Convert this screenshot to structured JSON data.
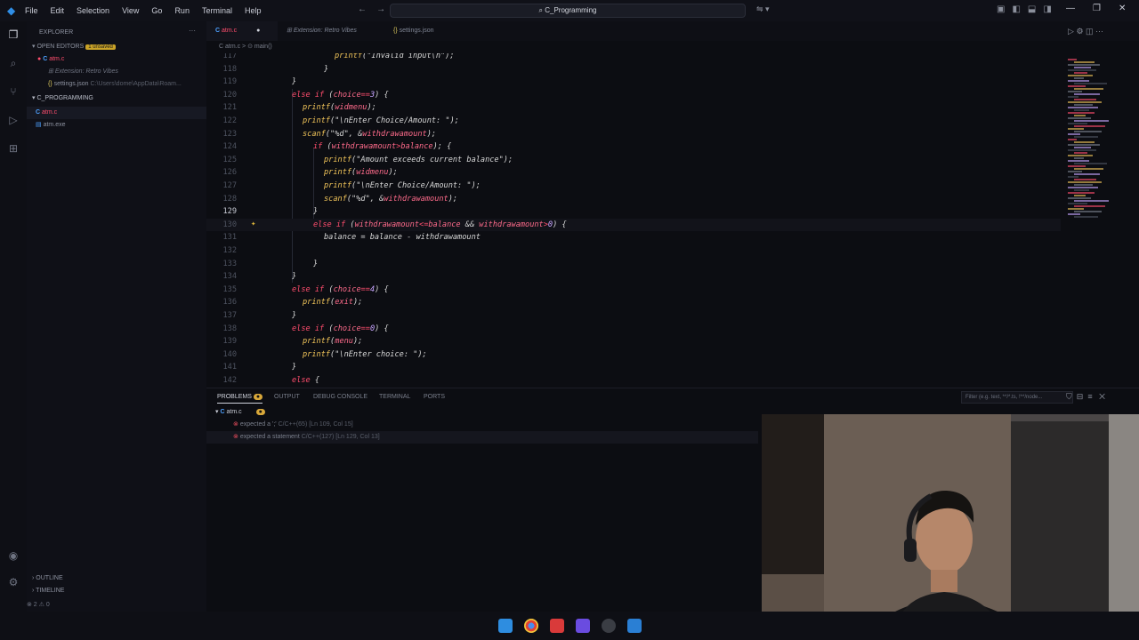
{
  "titlebar": {
    "menu": [
      "File",
      "Edit",
      "Selection",
      "View",
      "Go",
      "Run",
      "Terminal",
      "Help"
    ],
    "search": "C_Programming"
  },
  "sidebar": {
    "title": "EXPLORER",
    "open_editors_label": "OPEN EDITORS",
    "unsaved_badge": "1 unsaved",
    "open_editors": [
      {
        "name": "atm.c",
        "detail": ""
      },
      {
        "name": "Extension: Retro Vibes",
        "detail": ""
      },
      {
        "name": "settings.json",
        "detail": "C:\\Users\\dome\\AppData\\Roam..."
      }
    ],
    "folder_label": "C_PROGRAMMING",
    "files": [
      "atm.c",
      "atm.exe"
    ],
    "outline_label": "OUTLINE",
    "timeline_label": "TIMELINE"
  },
  "tabs": [
    {
      "label": "atm.c",
      "active": true
    },
    {
      "label": "Extension: Retro Vibes",
      "active": false
    },
    {
      "label": "settings.json",
      "active": false
    }
  ],
  "breadcrumb": "C atm.c > ⊙ main()",
  "code_lines": [
    {
      "n": "117",
      "indent": 8,
      "tokens": [
        [
          "fn",
          "printf"
        ],
        [
          "str",
          "(\"Invalid input\\n\");"
        ]
      ]
    },
    {
      "n": "118",
      "indent": 6,
      "tokens": [
        [
          "str",
          "}"
        ]
      ]
    },
    {
      "n": "119",
      "indent": 0,
      "tokens": [
        [
          "str",
          "}"
        ]
      ]
    },
    {
      "n": "120",
      "indent": 0,
      "tokens": [
        [
          "kw",
          "else if"
        ],
        [
          "str",
          " ("
        ],
        [
          "var",
          "choice"
        ],
        [
          "kw",
          "=="
        ],
        [
          "num",
          "3"
        ],
        [
          "str",
          ") {"
        ]
      ]
    },
    {
      "n": "121",
      "indent": 2,
      "tokens": [
        [
          "fn",
          "printf"
        ],
        [
          "str",
          "("
        ],
        [
          "var",
          "widmenu"
        ],
        [
          "str",
          ");"
        ]
      ]
    },
    {
      "n": "122",
      "indent": 2,
      "tokens": [
        [
          "fn",
          "printf"
        ],
        [
          "str",
          "(\"\\nEnter Choice/Amount: \");"
        ]
      ]
    },
    {
      "n": "123",
      "indent": 2,
      "tokens": [
        [
          "fn",
          "scanf"
        ],
        [
          "str",
          "(\"%d\", &"
        ],
        [
          "var",
          "withdrawamount"
        ],
        [
          "str",
          ");"
        ]
      ]
    },
    {
      "n": "124",
      "indent": 4,
      "tokens": [
        [
          "kw",
          "if"
        ],
        [
          "str",
          " ("
        ],
        [
          "var",
          "withdrawamount"
        ],
        [
          "kw",
          ">"
        ],
        [
          "var",
          "balance"
        ],
        [
          "str",
          "); {"
        ]
      ]
    },
    {
      "n": "125",
      "indent": 6,
      "tokens": [
        [
          "fn",
          "printf"
        ],
        [
          "str",
          "(\"Amount exceeds current balance\");"
        ]
      ]
    },
    {
      "n": "126",
      "indent": 6,
      "tokens": [
        [
          "fn",
          "printf"
        ],
        [
          "str",
          "("
        ],
        [
          "var",
          "widmenu"
        ],
        [
          "str",
          ");"
        ]
      ]
    },
    {
      "n": "127",
      "indent": 6,
      "tokens": [
        [
          "fn",
          "printf"
        ],
        [
          "str",
          "(\"\\nEnter Choice/Amount: \");"
        ]
      ]
    },
    {
      "n": "128",
      "indent": 6,
      "tokens": [
        [
          "fn",
          "scanf"
        ],
        [
          "str",
          "(\"%d\", &"
        ],
        [
          "var",
          "withdrawamount"
        ],
        [
          "str",
          ");"
        ]
      ]
    },
    {
      "n": "129",
      "indent": 4,
      "tokens": [
        [
          "str",
          "}"
        ]
      ]
    },
    {
      "n": "130",
      "indent": 4,
      "tokens": [
        [
          "kw",
          "else if"
        ],
        [
          "str",
          " ("
        ],
        [
          "var",
          "withdrawamount"
        ],
        [
          "kw",
          "<="
        ],
        [
          "var",
          "balance"
        ],
        [
          "str",
          " && "
        ],
        [
          "var",
          "withdrawamount"
        ],
        [
          "kw",
          ">"
        ],
        [
          "num",
          "0"
        ],
        [
          "str",
          ") {"
        ]
      ]
    },
    {
      "n": "131",
      "indent": 6,
      "tokens": [
        [
          "str",
          "balance = balance - withdrawamount"
        ]
      ]
    },
    {
      "n": "132",
      "indent": 0,
      "tokens": []
    },
    {
      "n": "133",
      "indent": 4,
      "tokens": [
        [
          "str",
          "}"
        ]
      ]
    },
    {
      "n": "134",
      "indent": 0,
      "tokens": [
        [
          "str",
          "}"
        ]
      ]
    },
    {
      "n": "135",
      "indent": 0,
      "tokens": [
        [
          "kw",
          "else if"
        ],
        [
          "str",
          " ("
        ],
        [
          "var",
          "choice"
        ],
        [
          "kw",
          "=="
        ],
        [
          "num",
          "4"
        ],
        [
          "str",
          ") {"
        ]
      ]
    },
    {
      "n": "136",
      "indent": 2,
      "tokens": [
        [
          "fn",
          "printf"
        ],
        [
          "str",
          "("
        ],
        [
          "var",
          "exit"
        ],
        [
          "str",
          ");"
        ]
      ]
    },
    {
      "n": "137",
      "indent": 0,
      "tokens": [
        [
          "str",
          "}"
        ]
      ]
    },
    {
      "n": "138",
      "indent": 0,
      "tokens": [
        [
          "kw",
          "else if"
        ],
        [
          "str",
          " ("
        ],
        [
          "var",
          "choice"
        ],
        [
          "kw",
          "=="
        ],
        [
          "num",
          "0"
        ],
        [
          "str",
          ") {"
        ]
      ]
    },
    {
      "n": "139",
      "indent": 2,
      "tokens": [
        [
          "fn",
          "printf"
        ],
        [
          "str",
          "("
        ],
        [
          "var",
          "menu"
        ],
        [
          "str",
          ");"
        ]
      ]
    },
    {
      "n": "140",
      "indent": 2,
      "tokens": [
        [
          "fn",
          "printf"
        ],
        [
          "str",
          "(\"\\nEnter choice: \");"
        ]
      ]
    },
    {
      "n": "141",
      "indent": 0,
      "tokens": [
        [
          "str",
          "}"
        ]
      ]
    },
    {
      "n": "142",
      "indent": 0,
      "tokens": [
        [
          "kw",
          "else"
        ],
        [
          "str",
          " {"
        ]
      ]
    }
  ],
  "panel": {
    "tabs": [
      "PROBLEMS",
      "OUTPUT",
      "DEBUG CONSOLE",
      "TERMINAL",
      "PORTS"
    ],
    "filter_placeholder": "Filter (e.g. text, **/*.ts, !**/node...",
    "file": "atm.c",
    "problems": [
      {
        "text": "expected a ';'",
        "source": "C/C++(65)",
        "loc": "[Ln 109, Col 15]"
      },
      {
        "text": "expected a statement",
        "source": "C/C++(127)",
        "loc": "[Ln 129, Col 13]"
      }
    ]
  },
  "status": "⊗ 2  ⚠ 0"
}
